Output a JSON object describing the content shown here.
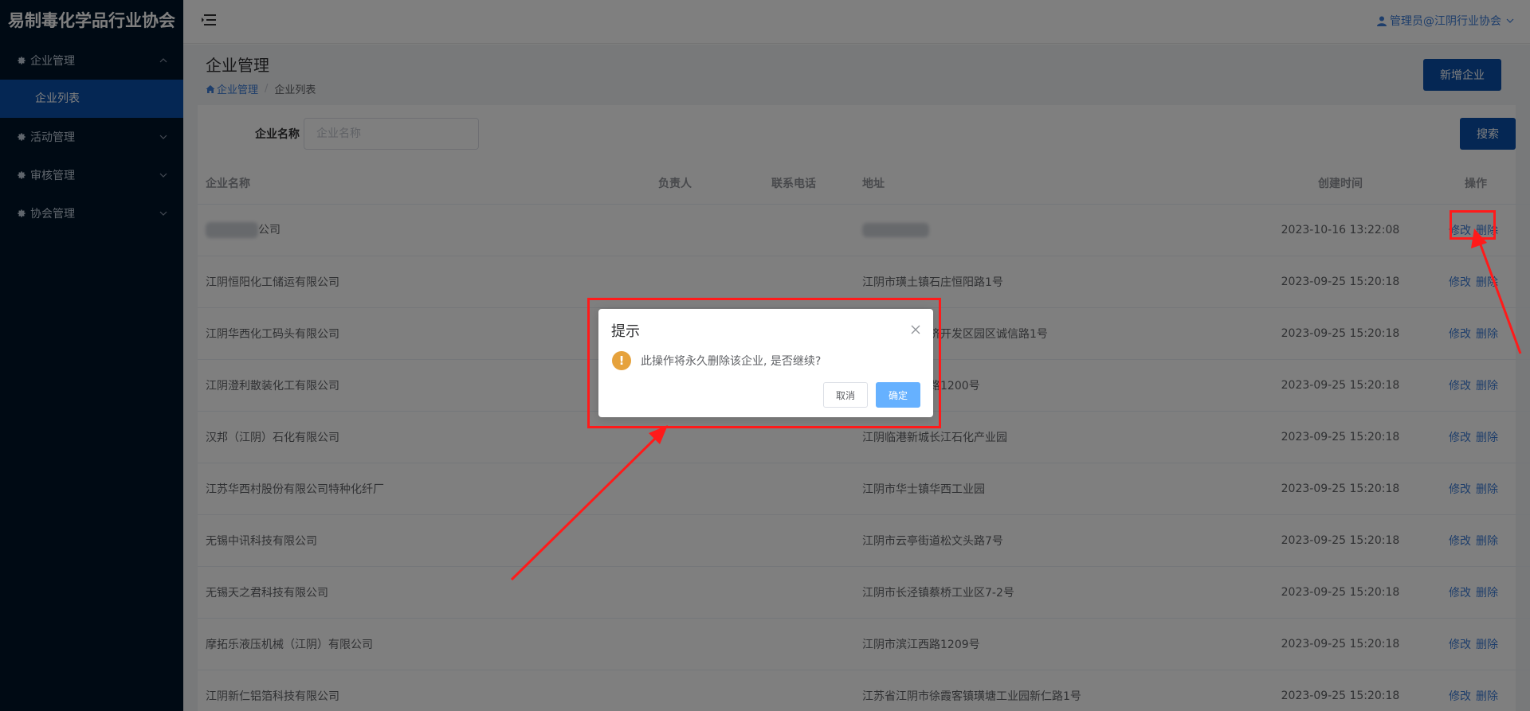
{
  "sidebar": {
    "logo": "易制毒化学品行业协会",
    "menus": [
      {
        "label": "企业管理",
        "icon": "gear-icon",
        "expanded": true,
        "children": [
          {
            "label": "企业列表",
            "active": true
          }
        ]
      },
      {
        "label": "活动管理",
        "icon": "gear-icon",
        "expanded": false
      },
      {
        "label": "审核管理",
        "icon": "gear-icon",
        "expanded": false
      },
      {
        "label": "协会管理",
        "icon": "gear-icon",
        "expanded": false
      }
    ]
  },
  "header": {
    "user_label": "管理员@江阴行业协会",
    "user_icon": "user-icon",
    "menu_icon": "hamburger-icon"
  },
  "page": {
    "title": "企业管理",
    "breadcrumb": [
      "企业管理",
      "企业列表"
    ],
    "add_button": "新增企业"
  },
  "search": {
    "label": "企业名称",
    "placeholder": "企业名称",
    "button": "搜索"
  },
  "table": {
    "columns": [
      "企业名称",
      "负责人",
      "联系电话",
      "地址",
      "创建时间",
      "操作"
    ],
    "edit_label": "修改",
    "delete_label": "删除",
    "rows": [
      {
        "name": "公司",
        "manager": "",
        "phone": "",
        "address": "",
        "created": "2023-10-16 13:22:08"
      },
      {
        "name": "江阴恒阳化工储运有限公司",
        "manager": "",
        "phone": "",
        "address": "江阴市璜土镇石庄恒阳路1号",
        "created": "2023-09-25 15:20:18"
      },
      {
        "name": "江阴华西化工码头有限公司",
        "manager": "",
        "phone": "",
        "address": "江阴市临港经济开发区园区诚信路1号",
        "created": "2023-09-25 15:20:18"
      },
      {
        "name": "江阴澄利散装化工有限公司",
        "manager": "",
        "phone": "",
        "address": "江阴市滨江西路1200号",
        "created": "2023-09-25 15:20:18"
      },
      {
        "name": "汉邦（江阴）石化有限公司",
        "manager": "",
        "phone": "",
        "address": "江阴临港新城长江石化产业园",
        "created": "2023-09-25 15:20:18"
      },
      {
        "name": "江苏华西村股份有限公司特种化纤厂",
        "manager": "",
        "phone": "",
        "address": "江阴市华士镇华西工业园",
        "created": "2023-09-25 15:20:18"
      },
      {
        "name": "无锡中讯科技有限公司",
        "manager": "",
        "phone": "",
        "address": "江阴市云亭街道松文头路7号",
        "created": "2023-09-25 15:20:18"
      },
      {
        "name": "无锡天之君科技有限公司",
        "manager": "",
        "phone": "",
        "address": "江阴市长泾镇蔡桥工业区7-2号",
        "created": "2023-09-25 15:20:18"
      },
      {
        "name": "摩拓乐液压机械（江阴）有限公司",
        "manager": "",
        "phone": "",
        "address": "江阴市滨江西路1209号",
        "created": "2023-09-25 15:20:18"
      },
      {
        "name": "江阴新仁铝箔科技有限公司",
        "manager": "",
        "phone": "",
        "address": "江苏省江阴市徐霞客镇璜塘工业园新仁路1号",
        "created": "2023-09-25 15:20:18"
      }
    ]
  },
  "dialog": {
    "title": "提示",
    "message": "此操作将永久删除该企业, 是否继续?",
    "cancel": "取消",
    "confirm": "确定",
    "icon": "warning-icon",
    "warn_glyph": "!"
  },
  "colors": {
    "sidebar_bg": "#001529",
    "active_item": "#0a4fa8",
    "primary": "#0a4fa8",
    "link": "#3d7cd6",
    "confirm_btn": "#66b1ff",
    "warning": "#e6a23c",
    "annotation": "#ff1a1a"
  }
}
